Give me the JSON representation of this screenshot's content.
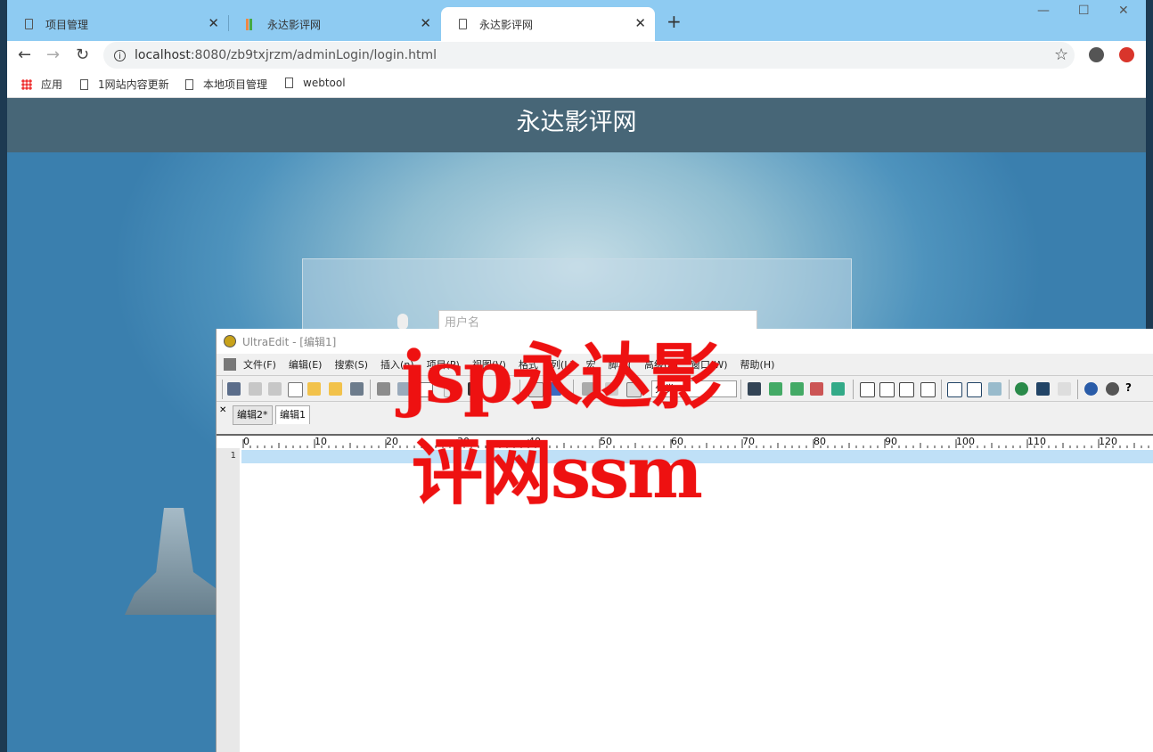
{
  "browser": {
    "tabs": [
      {
        "label": "项目管理",
        "active": false
      },
      {
        "label": "永达影评网",
        "active": false
      },
      {
        "label": "永达影评网",
        "active": true
      }
    ],
    "url_host": "localhost",
    "url_path": ":8080/zb9txjrzm/adminLogin/login.html",
    "bookmarks": [
      {
        "label": "应用",
        "icon": "apps-icon"
      },
      {
        "label": "1网站内容更新",
        "icon": "page-icon"
      },
      {
        "label": "本地项目管理",
        "icon": "page-icon"
      },
      {
        "label": "webtool",
        "icon": "page-icon"
      }
    ]
  },
  "site": {
    "title": "永达影评网",
    "username_placeholder": "用户名"
  },
  "ultraedit": {
    "title": "UltraEdit - [编辑1]",
    "menu": [
      "文件(F)",
      "编辑(E)",
      "搜索(S)",
      "插入(n)",
      "项目(P)",
      "视图(V)",
      "格式",
      "列(L)",
      "宏",
      "脚本(",
      "高级(A)",
      "窗口(W)",
      "帮助(H)"
    ],
    "category_label": "分类",
    "file_tabs": [
      {
        "label": "编辑2*",
        "active": false
      },
      {
        "label": "编辑1",
        "active": true
      }
    ],
    "ruler_labels": [
      "0",
      "10",
      "20",
      "30",
      "40",
      "50",
      "60",
      "70",
      "80",
      "90",
      "100",
      "110",
      "120"
    ],
    "line_number": "1"
  },
  "overlay": {
    "line1": "jsp永达影",
    "line2": "评网ssm",
    "color": "#ee1111"
  }
}
